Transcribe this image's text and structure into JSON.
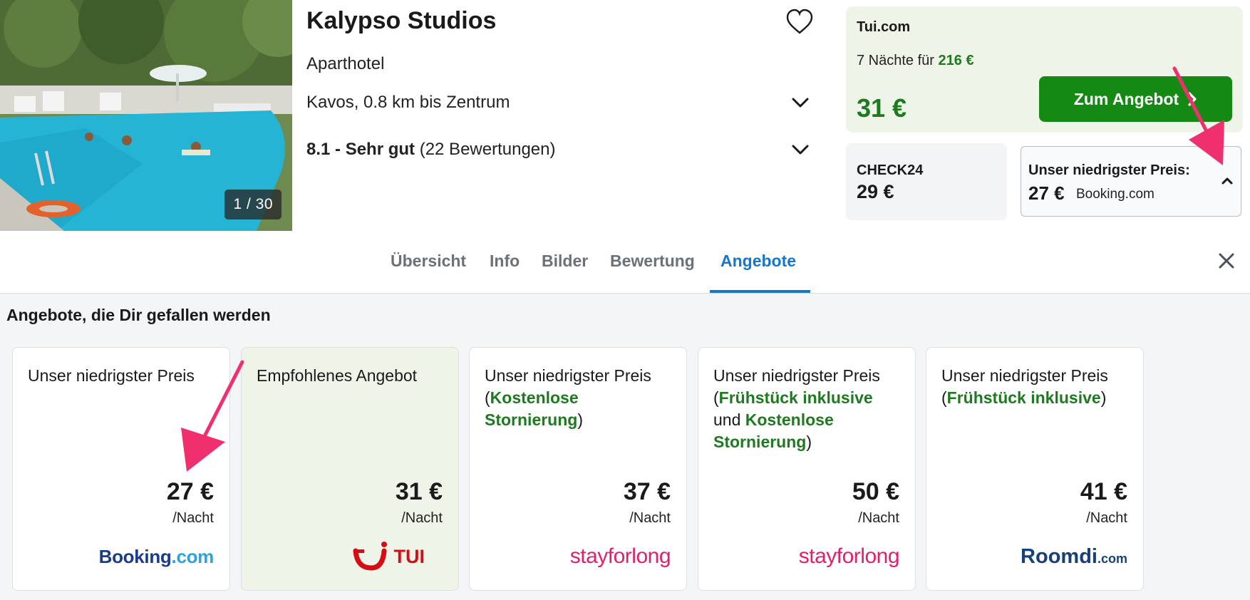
{
  "hotel": {
    "photo_counter": "1 / 30",
    "name": "Kalypso Studios",
    "type": "Aparthotel",
    "location": "Kavos, 0.8 km bis Zentrum",
    "rating_score": "8.1 - Sehr gut",
    "rating_count": "(22 Bewertungen)"
  },
  "featured_offer": {
    "provider": "Tui.com",
    "nights_text": "7 Nächte für",
    "nights_total": "216 €",
    "price": "31 €",
    "button_label": "Zum Angebot"
  },
  "alt_offer": {
    "provider": "CHECK24",
    "price": "29 €"
  },
  "lowest_price": {
    "label": "Unser niedrigster Preis:",
    "price": "27 €",
    "provider": "Booking.com"
  },
  "tabs": [
    {
      "label": "Übersicht",
      "active": false
    },
    {
      "label": "Info",
      "active": false
    },
    {
      "label": "Bilder",
      "active": false
    },
    {
      "label": "Bewertung",
      "active": false
    },
    {
      "label": "Angebote",
      "active": true
    }
  ],
  "offers_section": {
    "title": "Angebote, die Dir gefallen werden",
    "cards": [
      {
        "title": "Unser niedrigster Preis",
        "price": "27 €",
        "unit": "/Nacht",
        "logo": "Booking.com",
        "logo_main": "Booking",
        "logo_suffix": ".com"
      },
      {
        "title": "Empfohlenes Angebot",
        "price": "31 €",
        "unit": "/Nacht",
        "logo": "TUI"
      },
      {
        "title_prefix": "Unser niedrigster Preis",
        "title_open": "(",
        "title_hl1": "Kostenlose Stornierung",
        "title_close": ")",
        "price": "37 €",
        "unit": "/Nacht",
        "logo": "stayforlong"
      },
      {
        "title_prefix": "Unser niedrigster Preis",
        "title_open": "(",
        "title_hl1": "Frühstück inklusive",
        "title_mid": "und",
        "title_hl2": "Kostenlose Stornierung",
        "title_close": ")",
        "price": "50 €",
        "unit": "/Nacht",
        "logo": "stayforlong"
      },
      {
        "title_prefix": "Unser niedrigster Preis",
        "title_open": "(",
        "title_hl1": "Frühstück inklusive",
        "title_close": ")",
        "price": "41 €",
        "unit": "/Nacht",
        "logo": "Roomdi.com",
        "logo_main": "Roomdi",
        "logo_suffix": ".com"
      }
    ]
  },
  "colors": {
    "accent_blue": "#1577c9",
    "offer_green": "#148a14",
    "price_green": "#1e7a1e",
    "annotation_pink": "#f0306e"
  },
  "icons": [
    "heart-icon",
    "chevron-down-icon",
    "chevron-right-icon",
    "chevron-up-icon",
    "close-icon",
    "annotation-arrow"
  ]
}
